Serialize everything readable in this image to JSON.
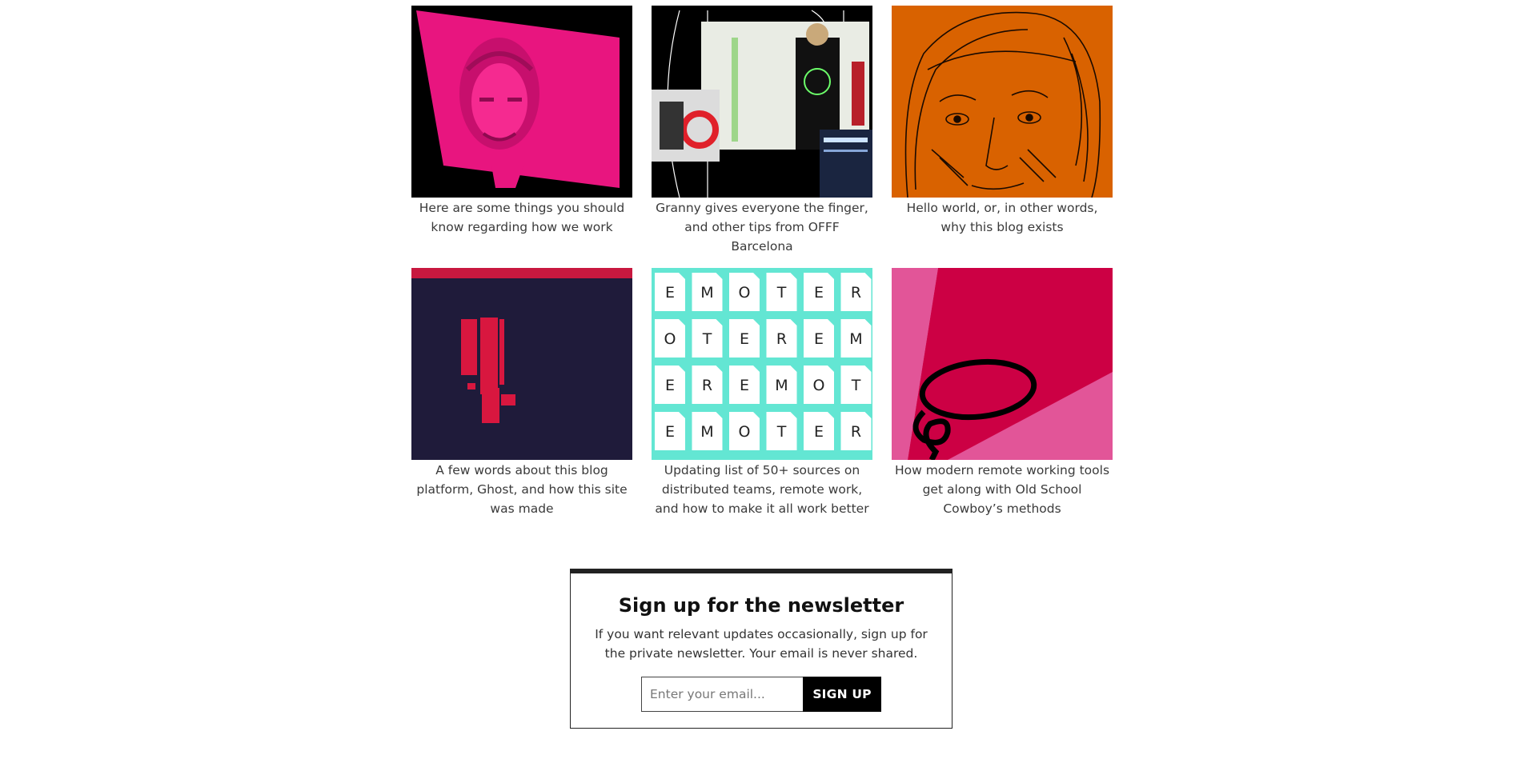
{
  "posts": [
    {
      "caption": "Here are some things you should know regarding how we work",
      "icon": "pink-portrait-image",
      "accent": "#e8157f"
    },
    {
      "caption": "Granny gives everyone the finger, and other tips from OFFF Barcelona",
      "icon": "event-collage-image",
      "accent": "#000000"
    },
    {
      "caption": "Hello world, or, in other words, why this blog exists",
      "icon": "sketch-portrait-image",
      "accent": "#d96200"
    },
    {
      "caption": "A few words about this blog platform, Ghost, and how this site was made",
      "icon": "exclamation-pattern-image",
      "accent": "#1f1b3a"
    },
    {
      "caption": "Updating list of 50+ sources on distributed teams, remote work, and how to make it all work better",
      "icon": "emoter-letters-image",
      "accent": "#63e6d3"
    },
    {
      "caption": "How modern remote working tools get along with Old School Cowboy’s methods",
      "icon": "lasso-image",
      "accent": "#cc0044"
    }
  ],
  "emoter_rows": [
    [
      "E",
      "M",
      "O",
      "T",
      "E",
      "R"
    ],
    [
      "O",
      "T",
      "E",
      "R",
      "E",
      "M"
    ],
    [
      "E",
      "R",
      "E",
      "M",
      "O",
      "T"
    ],
    [
      "E",
      "M",
      "O",
      "T",
      "E",
      "R"
    ]
  ],
  "newsletter": {
    "title": "Sign up for the newsletter",
    "description": "If you want relevant updates occasionally, sign up for the private newsletter. Your email is never shared.",
    "email_placeholder": "Enter your email...",
    "button_label": "SIGN UP"
  }
}
